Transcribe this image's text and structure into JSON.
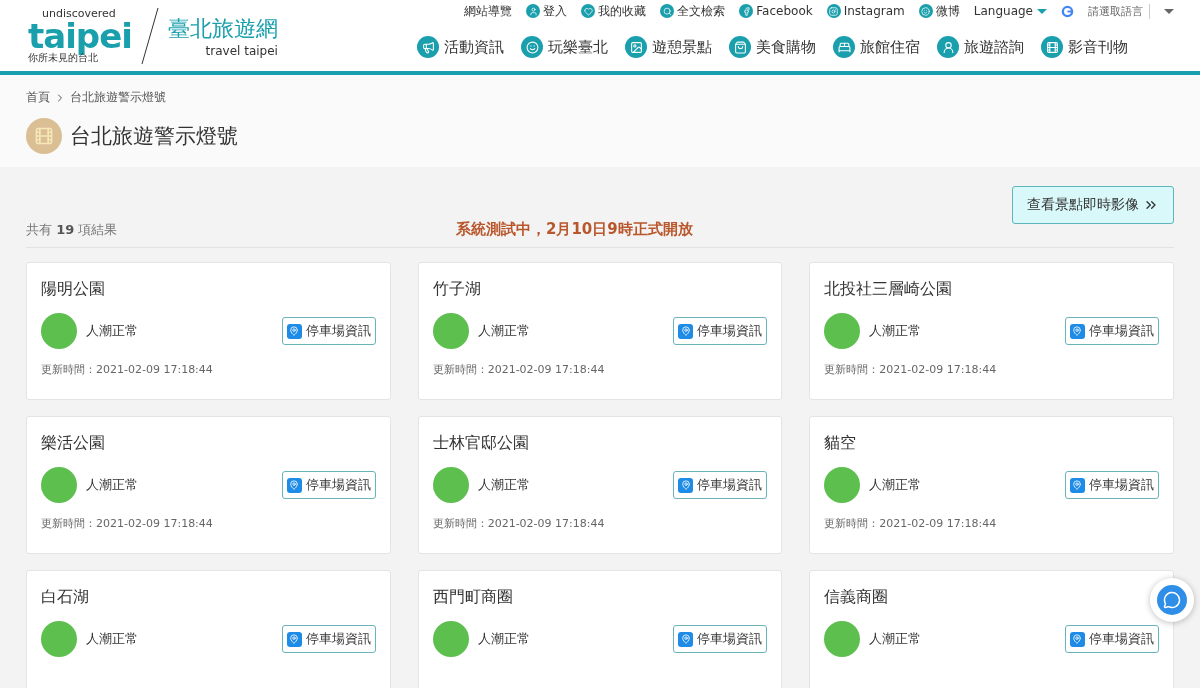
{
  "logo": {
    "tagline": "undiscovered",
    "wordmark": "taipei",
    "motto": "你所未見的台北",
    "site_name": "臺北旅遊網",
    "site_name_en": "travel taipei"
  },
  "top_links": [
    {
      "label": "網站導覽"
    },
    {
      "label": "登入"
    },
    {
      "label": "我的收藏"
    },
    {
      "label": "全文檢索"
    },
    {
      "label": "Facebook"
    },
    {
      "label": "Instagram"
    },
    {
      "label": "微博"
    }
  ],
  "language": {
    "label": "Language"
  },
  "translate": {
    "label": "請選取語言"
  },
  "nav": [
    {
      "label": "活動資訊"
    },
    {
      "label": "玩樂臺北"
    },
    {
      "label": "遊憩景點"
    },
    {
      "label": "美食購物"
    },
    {
      "label": "旅館住宿"
    },
    {
      "label": "旅遊諮詢"
    },
    {
      "label": "影音刊物"
    }
  ],
  "breadcrumb": [
    "首頁",
    "台北旅遊警示燈號"
  ],
  "page_title": "台北旅遊警示燈號",
  "live_button": "查看景點即時影像",
  "results": {
    "prefix": "共有",
    "count": "19",
    "suffix": "項結果"
  },
  "notice": "系統測試中，2月10日9時正式開放",
  "cards": [
    {
      "name": "陽明公園",
      "status": "人潮正常",
      "color": "#5cbf4e",
      "parking": "停車場資訊",
      "updated": "更新時間：2021-02-09 17:18:44"
    },
    {
      "name": "竹子湖",
      "status": "人潮正常",
      "color": "#5cbf4e",
      "parking": "停車場資訊",
      "updated": "更新時間：2021-02-09 17:18:44"
    },
    {
      "name": "北投社三層崎公園",
      "status": "人潮正常",
      "color": "#5cbf4e",
      "parking": "停車場資訊",
      "updated": "更新時間：2021-02-09 17:18:44"
    },
    {
      "name": "樂活公園",
      "status": "人潮正常",
      "color": "#5cbf4e",
      "parking": "停車場資訊",
      "updated": "更新時間：2021-02-09 17:18:44"
    },
    {
      "name": "士林官邸公園",
      "status": "人潮正常",
      "color": "#5cbf4e",
      "parking": "停車場資訊",
      "updated": "更新時間：2021-02-09 17:18:44"
    },
    {
      "name": "貓空",
      "status": "人潮正常",
      "color": "#5cbf4e",
      "parking": "停車場資訊",
      "updated": "更新時間：2021-02-09 17:18:44"
    },
    {
      "name": "白石湖",
      "status": "人潮正常",
      "color": "#5cbf4e",
      "parking": "停車場資訊"
    },
    {
      "name": "西門町商圈",
      "status": "人潮正常",
      "color": "#5cbf4e",
      "parking": "停車場資訊"
    },
    {
      "name": "信義商圈",
      "status": "人潮正常",
      "color": "#5cbf4e",
      "parking": "停車場資訊"
    }
  ]
}
